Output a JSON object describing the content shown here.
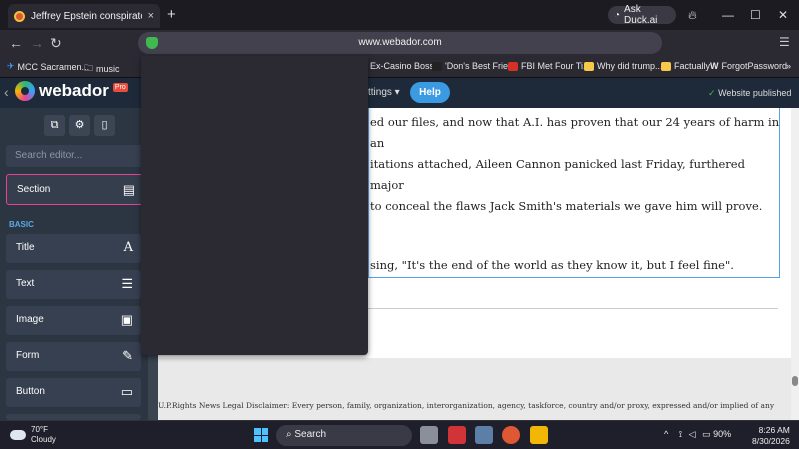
{
  "browser": {
    "tab_title": "Jeffrey Epstein conspirator, St",
    "tab_close": "×",
    "new_tab": "+",
    "ask_duckai": "Ask Duck.ai",
    "window_controls": {
      "minimize": "—",
      "maximize": "☐",
      "close": "✕"
    },
    "url": "www.webador.com"
  },
  "bookmarks": [
    {
      "label": "MCC Sacramen...",
      "icon": "plane-icon",
      "color": "#3aa0ff"
    },
    {
      "label": "music",
      "icon": "folder-icon",
      "color": "#e6e6e6"
    },
    {
      "label": "Ex-Casino Boss...",
      "icon": "",
      "color": ""
    },
    {
      "label": "'Don's Best Frie...",
      "icon": "site-icon",
      "color": "#222222"
    },
    {
      "label": "FBI Met Four Ti...",
      "icon": "site-icon",
      "color": "#d93025"
    },
    {
      "label": "Why did trump...",
      "icon": "site-icon",
      "color": "#f7c948"
    },
    {
      "label": "Factually",
      "icon": "site-icon",
      "color": "#f7c948"
    },
    {
      "label": "ForgotPassword",
      "icon": "w-icon",
      "color": "#ffffff"
    }
  ],
  "editor": {
    "logo": "webador",
    "pro_badge": "Pro",
    "settings_menu": "ttings ▾",
    "help_button": "Help",
    "status": "Website published",
    "search_placeholder": "Search editor...",
    "section_label": "Section",
    "category": "BASIC",
    "blocks": [
      {
        "label": "Title",
        "icon": "A"
      },
      {
        "label": "Text",
        "icon": "☰"
      },
      {
        "label": "Image",
        "icon": "▣"
      },
      {
        "label": "Form",
        "icon": "✎"
      },
      {
        "label": "Button",
        "icon": "▭"
      }
    ]
  },
  "page": {
    "paragraph_lines": [
      "ed our files, and now that A.I. has proven that our 24 years of harm in an",
      "itations attached, Aileen Cannon panicked last Friday, furthered major",
      "to conceal the flaws Jack Smith's materials we gave him will prove."
    ],
    "quote_line": "sing, \"It's the end of the world as they know it, but I feel fine\".",
    "disclaimer": "U.P.Rights News Legal Disclaimer: Every person, family, organization, interorganization, agency, taskforce, country and/or proxy,  expressed and/or implied of any"
  },
  "taskbar": {
    "temperature": "70°F",
    "condition": "Cloudy",
    "search_label": "Search",
    "battery": "90%",
    "time": "8:26 AM",
    "date": "8/30/2026"
  }
}
